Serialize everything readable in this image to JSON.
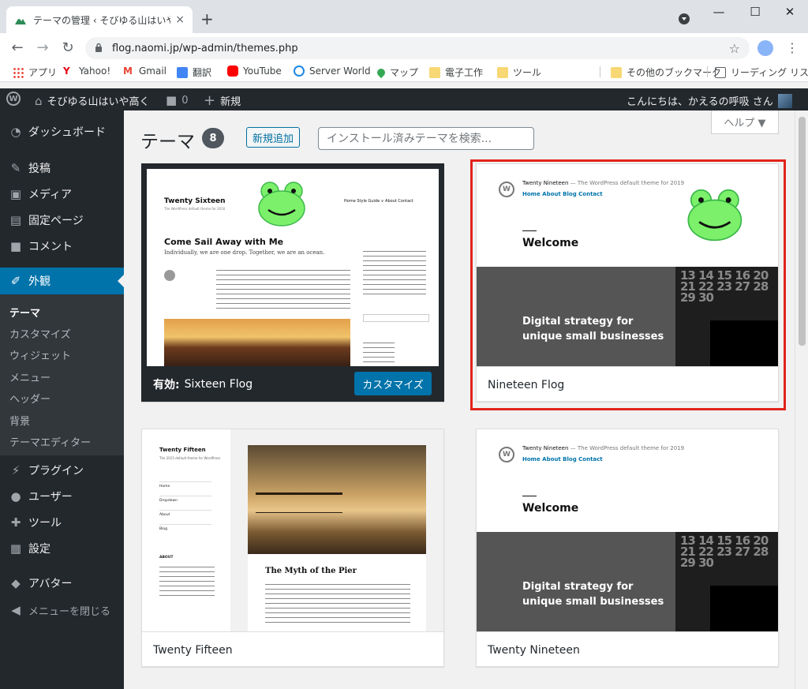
{
  "browser": {
    "tab_title": "テーマの管理 ‹ そびゆる山はいや高く",
    "tab_close": "×",
    "new_tab": "+",
    "url": "flog.naomi.jp/wp-admin/themes.php",
    "controls": {
      "minimize": "—",
      "maximize": "☐",
      "close": "✕"
    },
    "nav": {
      "back": "←",
      "forward": "→",
      "reload": "↻"
    },
    "bookmarks": [
      {
        "label": "アプリ"
      },
      {
        "label": "Yahoo!"
      },
      {
        "label": "Gmail"
      },
      {
        "label": "翻訳"
      },
      {
        "label": "YouTube"
      },
      {
        "label": "Server World"
      },
      {
        "label": "マップ"
      },
      {
        "label": "電子工作"
      },
      {
        "label": "ツール"
      },
      {
        "label": "その他のブックマーク"
      },
      {
        "label": "リーディング リスト"
      }
    ]
  },
  "adminbar": {
    "site_name": "そびゆる山はいや高く",
    "comments_count": "0",
    "new_label": "新規",
    "greeting": "こんにちは、かえるの呼吸 さん"
  },
  "sidebar": {
    "items": [
      {
        "label": "ダッシュボード",
        "icon": "dashboard-icon"
      },
      {
        "label": "投稿",
        "icon": "pin-icon"
      },
      {
        "label": "メディア",
        "icon": "media-icon"
      },
      {
        "label": "固定ページ",
        "icon": "page-icon"
      },
      {
        "label": "コメント",
        "icon": "comment-icon"
      },
      {
        "label": "外観",
        "icon": "paintbrush-icon"
      },
      {
        "label": "プラグイン",
        "icon": "plugin-icon"
      },
      {
        "label": "ユーザー",
        "icon": "user-icon"
      },
      {
        "label": "ツール",
        "icon": "wrench-icon"
      },
      {
        "label": "設定",
        "icon": "settings-icon"
      },
      {
        "label": "アバター",
        "icon": "avatar-icon"
      },
      {
        "label": "メニューを閉じる",
        "icon": "collapse-icon"
      }
    ],
    "submenu": [
      "テーマ",
      "カスタマイズ",
      "ウィジェット",
      "メニュー",
      "ヘッダー",
      "背景",
      "テーマエディター"
    ]
  },
  "header": {
    "title": "テーマ",
    "count": "8",
    "add_new": "新規追加",
    "search_placeholder": "インストール済みテーマを検索...",
    "help": "ヘルプ ▼"
  },
  "themes": [
    {
      "name": "Sixteen Flog",
      "active_prefix": "有効:",
      "customize": "カスタマイズ",
      "preview": {
        "site_title": "Twenty Sixteen",
        "tagline": "The WordPress default theme for 2016",
        "nav": "Home   Style Guide ∨   About   Contact",
        "post_title": "Come Sail Away with Me",
        "lead": "Individually, we are one drop. Together, we are an ocean."
      }
    },
    {
      "name": "Nineteen Flog",
      "preview": {
        "site_title": "Twenty Nineteen",
        "tagline": "— The WordPress default theme for 2019",
        "nav": "Home  About  Blog  Contact",
        "welcome": "Welcome",
        "hero_line1": "Digital strategy for",
        "hero_line2": "unique small businesses",
        "calendar": "13 14 15 16 20 21 22 23 27 28 29 30"
      }
    },
    {
      "name": "Twenty Fifteen",
      "preview": {
        "site_title": "Twenty Fifteen",
        "tagline": "The 2015 default theme for WordPress",
        "menu": [
          "Home",
          "Dropdown",
          "About",
          "Blog"
        ],
        "widget": "ABOUT",
        "post_title": "The Myth of the Pier"
      }
    },
    {
      "name": "Twenty Nineteen",
      "preview": {
        "site_title": "Twenty Nineteen",
        "tagline": "— The WordPress default theme for 2019",
        "nav": "Home  About  Blog  Contact",
        "welcome": "Welcome",
        "hero_line1": "Digital strategy for",
        "hero_line2": "unique small businesses",
        "calendar": "13 14 15 16 20 21 22 23 27 28 29 30"
      }
    }
  ],
  "colors": {
    "accent": "#0073aa",
    "highlight": "#e2231a",
    "frog": "#7cf06a"
  }
}
